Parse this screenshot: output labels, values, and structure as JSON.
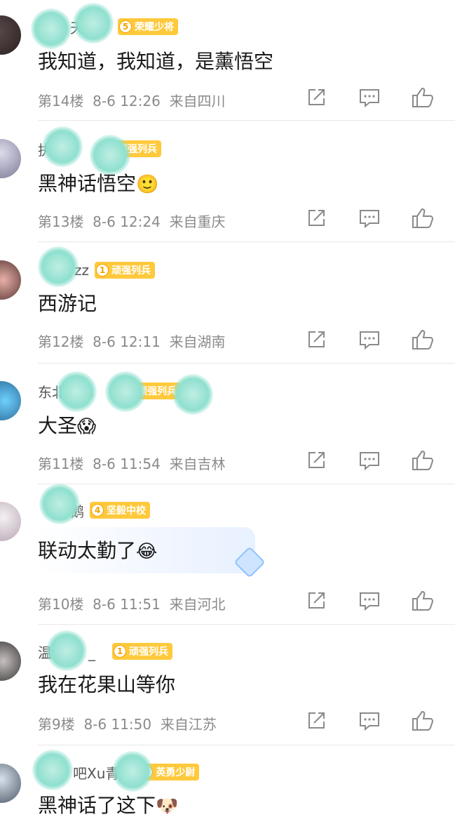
{
  "comments": [
    {
      "floor": "第14楼",
      "time": "8-6 12:26",
      "loc": "来自四川",
      "name": "天空、",
      "badge_lv": "5",
      "badge": "荣耀少将",
      "text": "我知道，我知道，是薰悟空",
      "emoji": ""
    },
    {
      "floor": "第13楼",
      "time": "8-6 12:24",
      "loc": "来自重庆",
      "name": "执少",
      "badge_lv": "1",
      "badge": "顽强列兵",
      "text": "黑神话悟空",
      "emoji": "🙂"
    },
    {
      "floor": "第12楼",
      "time": "8-6 12:11",
      "loc": "来自湖南",
      "name": "zz",
      "badge_lv": "1",
      "badge": "顽强列兵",
      "text": "西游记",
      "emoji": ""
    },
    {
      "floor": "第11楼",
      "time": "8-6 11:54",
      "loc": "来自吉林",
      "name": "东北艺术",
      "badge_lv": "1",
      "badge": "顽强列兵",
      "text": "大圣",
      "emoji": "😱"
    },
    {
      "floor": "第10楼",
      "time": "8-6 11:51",
      "loc": "来自河北",
      "name": "鹅",
      "badge_lv": "4",
      "badge": "坚毅中校",
      "text": "联动太勤了",
      "emoji": "😂"
    },
    {
      "floor": "第9楼",
      "time": "8-6 11:50",
      "loc": "来自江苏",
      "name": "温马_",
      "badge_lv": "1",
      "badge": "顽强列兵",
      "text": "我在花果山等你",
      "emoji": ""
    },
    {
      "floor": "",
      "time": "",
      "loc": "",
      "name": "吧Xu青春",
      "badge_lv": "3",
      "badge": "英勇少尉",
      "text": "黑神话了这下",
      "emoji": "🐶"
    }
  ],
  "icons": {
    "share": "share-icon",
    "reply": "comment-icon",
    "like": "thumbs-up-icon"
  },
  "colors": {
    "badge": "#ffc93c",
    "meta": "#8a8a8a",
    "blur": "#8fe0cf"
  }
}
